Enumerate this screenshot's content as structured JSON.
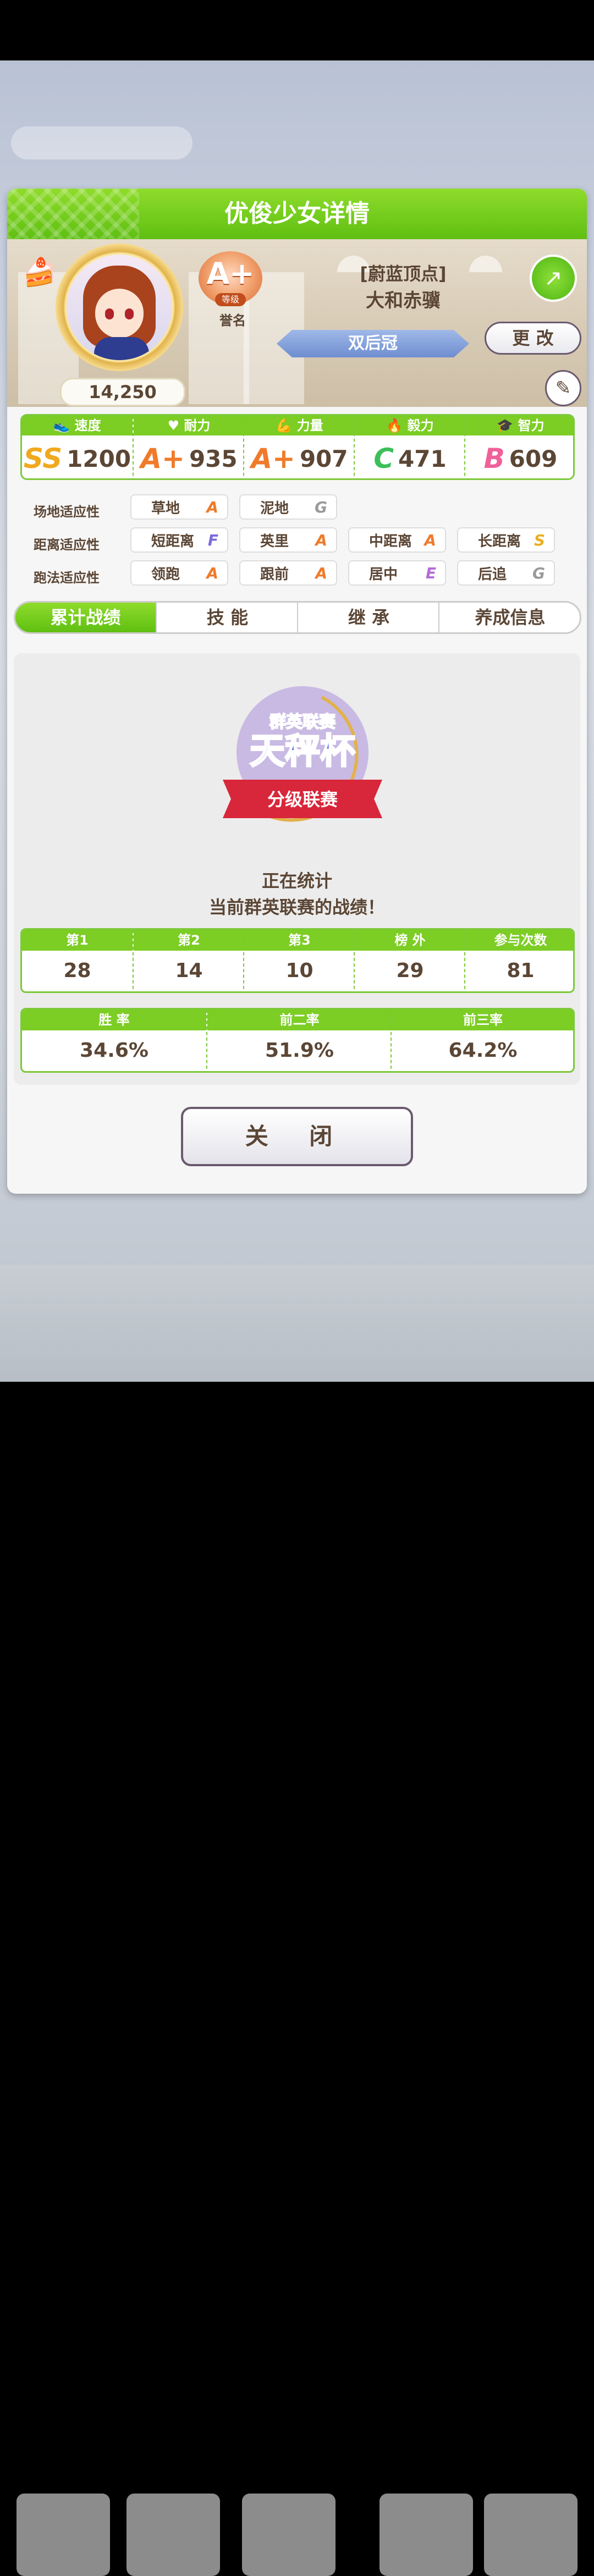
{
  "colors": {
    "accent_green": "#6cc91d",
    "text_brown": "#5b4635",
    "grade_ss": "#f0a81e",
    "grade_a": "#f07a2a",
    "grade_c": "#3cbf5a",
    "grade_b": "#f0609a",
    "grade_f": "#7a6be0",
    "grade_e": "#b46ad8",
    "grade_s": "#e8b020",
    "grade_g": "#9a9a9a"
  },
  "header": {
    "title": "优俊少女详情"
  },
  "profile": {
    "score": "14,250",
    "rank": {
      "grade": "A+",
      "sub": "等级",
      "title": "誉名"
    },
    "epithet": "[蔚蓝顶点]",
    "name": "大和赤骥",
    "honor_title": "双后冠",
    "share_icon": "share-icon",
    "change_label": "更 改",
    "edit_icon": "pencil-icon"
  },
  "stats": [
    {
      "label": "速度",
      "icon": "shoe-icon",
      "grade": "SS",
      "value": "1200"
    },
    {
      "label": "耐力",
      "icon": "heart-icon",
      "grade": "A+",
      "value": "935"
    },
    {
      "label": "力量",
      "icon": "muscle-icon",
      "grade": "A+",
      "value": "907"
    },
    {
      "label": "毅力",
      "icon": "flame-icon",
      "grade": "C",
      "value": "471"
    },
    {
      "label": "智力",
      "icon": "graduation-cap-icon",
      "grade": "B",
      "value": "609"
    }
  ],
  "aptitude": {
    "track_label": "场地适应性",
    "track": [
      {
        "name": "草地",
        "grade": "A"
      },
      {
        "name": "泥地",
        "grade": "G"
      }
    ],
    "distance_label": "距离适应性",
    "distance": [
      {
        "name": "短距离",
        "grade": "F"
      },
      {
        "name": "英里",
        "grade": "A"
      },
      {
        "name": "中距离",
        "grade": "A"
      },
      {
        "name": "长距离",
        "grade": "S"
      }
    ],
    "style_label": "跑法适应性",
    "style": [
      {
        "name": "领跑",
        "grade": "A"
      },
      {
        "name": "跟前",
        "grade": "A"
      },
      {
        "name": "居中",
        "grade": "E"
      },
      {
        "name": "后追",
        "grade": "G"
      }
    ]
  },
  "tabs": [
    {
      "label": "累计战绩"
    },
    {
      "label": "技 能"
    },
    {
      "label": "继 承"
    },
    {
      "label": "养成信息"
    }
  ],
  "league": {
    "logo_top": "群英联赛",
    "logo_main": "天秤杯",
    "logo_ribbon": "分级联赛",
    "message_line1": "正在统计",
    "message_line2": "当前群英联赛的战绩！"
  },
  "placements": {
    "headers": [
      "第1",
      "第2",
      "第3",
      "榜 外",
      "参与次数"
    ],
    "values": [
      "28",
      "14",
      "10",
      "29",
      "81"
    ]
  },
  "rates": {
    "headers": [
      "胜 率",
      "前二率",
      "前三率"
    ],
    "values": [
      "34.6%",
      "51.9%",
      "64.2%"
    ]
  },
  "close_label": "关 闭"
}
